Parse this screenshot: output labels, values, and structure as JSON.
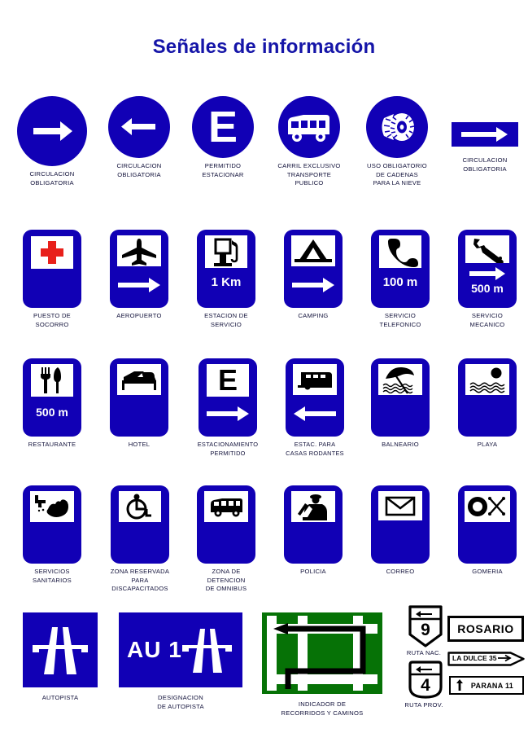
{
  "page": {
    "title": "Señales de información",
    "colors": {
      "sign_blue": "#1100b5",
      "title_blue": "#1515a8",
      "green": "#067206",
      "white": "#ffffff",
      "black": "#000000",
      "red_cross": "#e8201b",
      "caption": "#11113a"
    }
  },
  "rows": [
    {
      "name": "row-1",
      "signs": [
        {
          "id": "circulacion-obligatoria-derecha",
          "shape": "circle",
          "icon": "arrow-right-icon",
          "caption": "CIRCULACION\nOBLIGATORIA"
        },
        {
          "id": "circulacion-obligatoria-izquierda",
          "shape": "circle",
          "icon": "arrow-left-icon",
          "caption": "CIRCULACION\nOBLIGATORIA"
        },
        {
          "id": "permitido-estacionar",
          "shape": "circle",
          "icon": "letter-e-icon",
          "letter": "E",
          "caption": "PERMITIDO\nESTACIONAR"
        },
        {
          "id": "carril-exclusivo-transporte-publico",
          "shape": "circle",
          "icon": "bus-icon",
          "caption": "CARRIL EXCLUSIVO\nTRANSPORTE\nPUBLICO"
        },
        {
          "id": "uso-obligatorio-cadenas",
          "shape": "circle",
          "icon": "snow-chain-tire-icon",
          "caption": "USO OBLIGATORIO\nDE CADENAS\nPARA LA NIEVE"
        },
        {
          "id": "circulacion-obligatoria-rect",
          "shape": "rectangle",
          "icon": "arrow-right-icon",
          "caption": "CIRCULACION\nOBLIGATORIA"
        }
      ]
    },
    {
      "name": "row-2",
      "signs": [
        {
          "id": "puesto-de-socorro",
          "icon": "red-cross-icon",
          "caption": "PUESTO DE\nSOCORRO"
        },
        {
          "id": "aeropuerto",
          "icon": "airplane-icon",
          "sub": "arrow-right-icon",
          "caption": "AEROPUERTO"
        },
        {
          "id": "estacion-de-servicio",
          "icon": "fuel-pump-icon",
          "distance": "1 Km",
          "caption": "ESTACION DE\nSERVICIO"
        },
        {
          "id": "camping",
          "icon": "tent-icon",
          "sub": "arrow-right-icon",
          "caption": "CAMPING"
        },
        {
          "id": "servicio-telefonico",
          "icon": "telephone-icon",
          "distance": "100 m",
          "caption": "SERVICIO\nTELEFONICO"
        },
        {
          "id": "servicio-mecanico",
          "icon": "wrench-icon",
          "sub": "arrow-right-icon",
          "distance": "500 m",
          "caption": "SERVICIO\nMECANICO"
        }
      ]
    },
    {
      "name": "row-3",
      "signs": [
        {
          "id": "restaurante",
          "icon": "fork-knife-icon",
          "distance": "500 m",
          "caption": "RESTAURANTE"
        },
        {
          "id": "hotel",
          "icon": "bed-icon",
          "caption": "HOTEL"
        },
        {
          "id": "estacionamiento-permitido",
          "icon": "letter-e-icon",
          "letter": "E",
          "sub": "arrow-right-icon",
          "caption": "ESTACIONAMIENTO\nPERMITIDO"
        },
        {
          "id": "estac-para-casas-rodantes",
          "icon": "caravan-icon",
          "sub": "arrow-left-icon",
          "caption": "ESTAC. PARA\nCASAS RODANTES"
        },
        {
          "id": "balneario",
          "icon": "beach-umbrella-icon",
          "caption": "BALNEARIO"
        },
        {
          "id": "playa",
          "icon": "sun-water-icon",
          "caption": "PLAYA"
        }
      ]
    },
    {
      "name": "row-4",
      "signs": [
        {
          "id": "servicios-sanitarios",
          "icon": "handwash-icon",
          "caption": "SERVICIOS\nSANITARIOS"
        },
        {
          "id": "zona-reservada-discapacitados",
          "icon": "wheelchair-icon",
          "caption": "ZONA RESERVADA\nPARA\nDISCAPACITADOS"
        },
        {
          "id": "zona-de-detencion-de-omnibus",
          "icon": "bus-icon",
          "caption": "ZONA DE\nDETENCION\nDE OMNIBUS"
        },
        {
          "id": "policia",
          "icon": "police-officer-icon",
          "caption": "POLICIA"
        },
        {
          "id": "correo",
          "icon": "envelope-icon",
          "caption": "CORREO"
        },
        {
          "id": "gomeria",
          "icon": "tire-and-wrench-icon",
          "caption": "GOMERIA"
        }
      ]
    }
  ],
  "bottom": {
    "autopista": {
      "id": "autopista",
      "icon": "motorway-icon",
      "caption": "AUTOPISTA"
    },
    "designacion": {
      "id": "designacion-de-autopista",
      "icon": "motorway-icon",
      "label": "AU 1",
      "caption": "DESIGNACION\nDE AUTOPISTA"
    },
    "indicador": {
      "id": "indicador-de-recorridos",
      "icon": "route-diagram-icon",
      "caption": "INDICADOR DE\nRECORRIDOS Y CAMINOS"
    },
    "shields": [
      {
        "id": "ruta-nacional",
        "number": "9",
        "caption": "RUTA NAC.",
        "arrow": "arrow-left-icon"
      },
      {
        "id": "ruta-provincial",
        "number": "4",
        "caption": "RUTA PROV.",
        "arrow": "arrow-left-icon"
      }
    ],
    "destinations": [
      {
        "id": "destino-rosario",
        "text": "ROSARIO",
        "style": "plain"
      },
      {
        "id": "destino-la-dulce",
        "text": "LA DULCE 35",
        "style": "arrow-right"
      },
      {
        "id": "destino-parana",
        "text": "PARANA 11",
        "style": "arrow-up"
      }
    ]
  }
}
